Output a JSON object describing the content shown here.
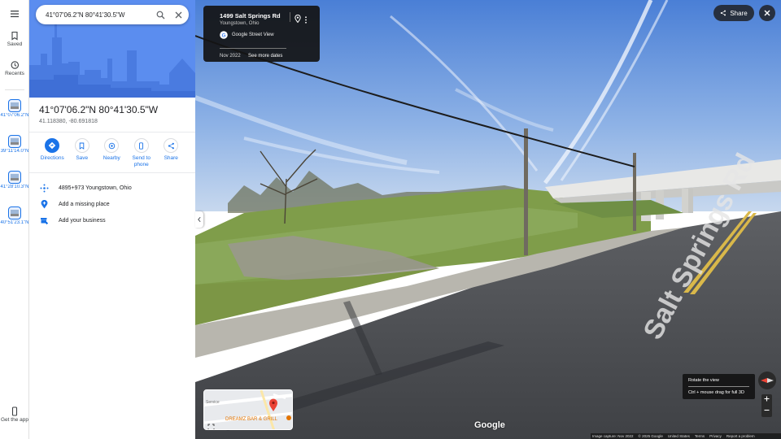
{
  "rail": {
    "saved_label": "Saved",
    "recents_label": "Recents",
    "get_app_label": "Get the app",
    "recent_items": [
      {
        "label": "41°07'06.2\"N"
      },
      {
        "label": "39°11'14.0\"N"
      },
      {
        "label": "41°28'10.3\"N"
      },
      {
        "label": "40°51'23.1\"N"
      }
    ]
  },
  "search": {
    "value": "41°07'06.2\"N 80°41'30.5\"W"
  },
  "place": {
    "title": "41°07'06.2\"N 80°41'30.5\"W",
    "coords": "41.118380, -80.691818"
  },
  "actions": [
    {
      "label": "Directions",
      "icon": "directions-icon"
    },
    {
      "label": "Save",
      "icon": "bookmark-icon"
    },
    {
      "label": "Nearby",
      "icon": "nearby-icon"
    },
    {
      "label": "Send to phone",
      "icon": "phone-icon"
    },
    {
      "label": "Share",
      "icon": "share-icon"
    }
  ],
  "info": {
    "plus_code": "4895+973 Youngstown, Ohio",
    "add_missing": "Add a missing place",
    "add_business": "Add your business"
  },
  "location_card": {
    "title": "1499 Salt Springs Rd",
    "subtitle": "Youngstown, Ohio",
    "source": "Google Street View",
    "date": "Nov 2022",
    "more_dates": "See more dates"
  },
  "share_label": "Share",
  "minimap": {
    "label1": "DREAMZ BAR & GRILL",
    "label2": "Service"
  },
  "google_logo": "Google",
  "tooltip": {
    "line1": "Rotate the view",
    "line2": "Ctrl + mouse drag for full 3D"
  },
  "footer": {
    "capture": "Image capture: Nov 2022",
    "copyright": "© 2025 Google",
    "country": "United States",
    "terms": "Terms",
    "privacy": "Privacy",
    "report": "Report a problem"
  },
  "road_text": "Salt Springs Rd",
  "colors": {
    "accent": "#1a73e8",
    "sky": "#5b8def"
  }
}
